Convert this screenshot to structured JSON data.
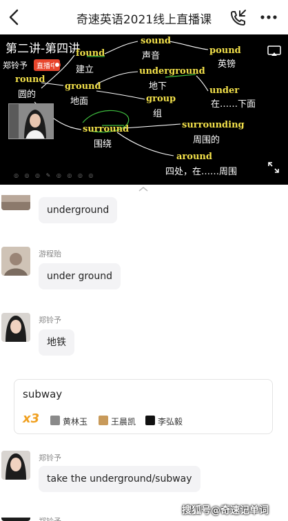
{
  "topbar": {
    "title": "奇速英语2021线上直播课",
    "back_icon": "chevron-left-icon",
    "call_icon": "phone-call-icon",
    "more_icon": "more-dots-icon"
  },
  "video": {
    "lecture_title": "第二讲-第四讲",
    "teacher_name": "郑铃予",
    "live_badge": "直播中",
    "words": {
      "found": "found",
      "found_cn": "建立",
      "round": "round",
      "round_cn": "圆的",
      "sound": "sound",
      "sound_cn": "声音",
      "pound": "pound",
      "pound_cn": "英镑",
      "ground": "ground",
      "ground_cn": "地面",
      "underground": "underground",
      "underground_cn": "地下",
      "under": "under",
      "under_cn": "在……下面",
      "group": "group",
      "group_cn": "组",
      "surround": "surround",
      "surround_cn": "围绕",
      "surrounding": "surrounding",
      "surrounding_cn": "周围的",
      "around": "around",
      "around_cn": "四处，在……周围"
    },
    "screen_icon": "cast-screen-icon",
    "expand_icon": "expand-icon",
    "tool_icons": "◎ ◎ ◎ ✎ ◎ ◎ ◎ ◎"
  },
  "chat": {
    "messages": [
      {
        "name": "",
        "text": "underground"
      },
      {
        "name": "游程贻",
        "text": "under ground"
      },
      {
        "name": "郑铃予",
        "text": "地铁"
      },
      {
        "name": "郑铃予",
        "text": "take the underground/subway"
      },
      {
        "name": "郑铃予",
        "text": ""
      }
    ],
    "card": {
      "text": "subway",
      "count": "x3",
      "users": [
        "黄林玉",
        "王晨凯",
        "李弘毅"
      ]
    }
  },
  "watermark": "搜狐号@奇速记单词",
  "colors": {
    "live_red": "#e8452c",
    "highlight_yellow": "#f2e04a",
    "count_orange": "#f0a020",
    "annotation_green": "#3fbf3f"
  }
}
